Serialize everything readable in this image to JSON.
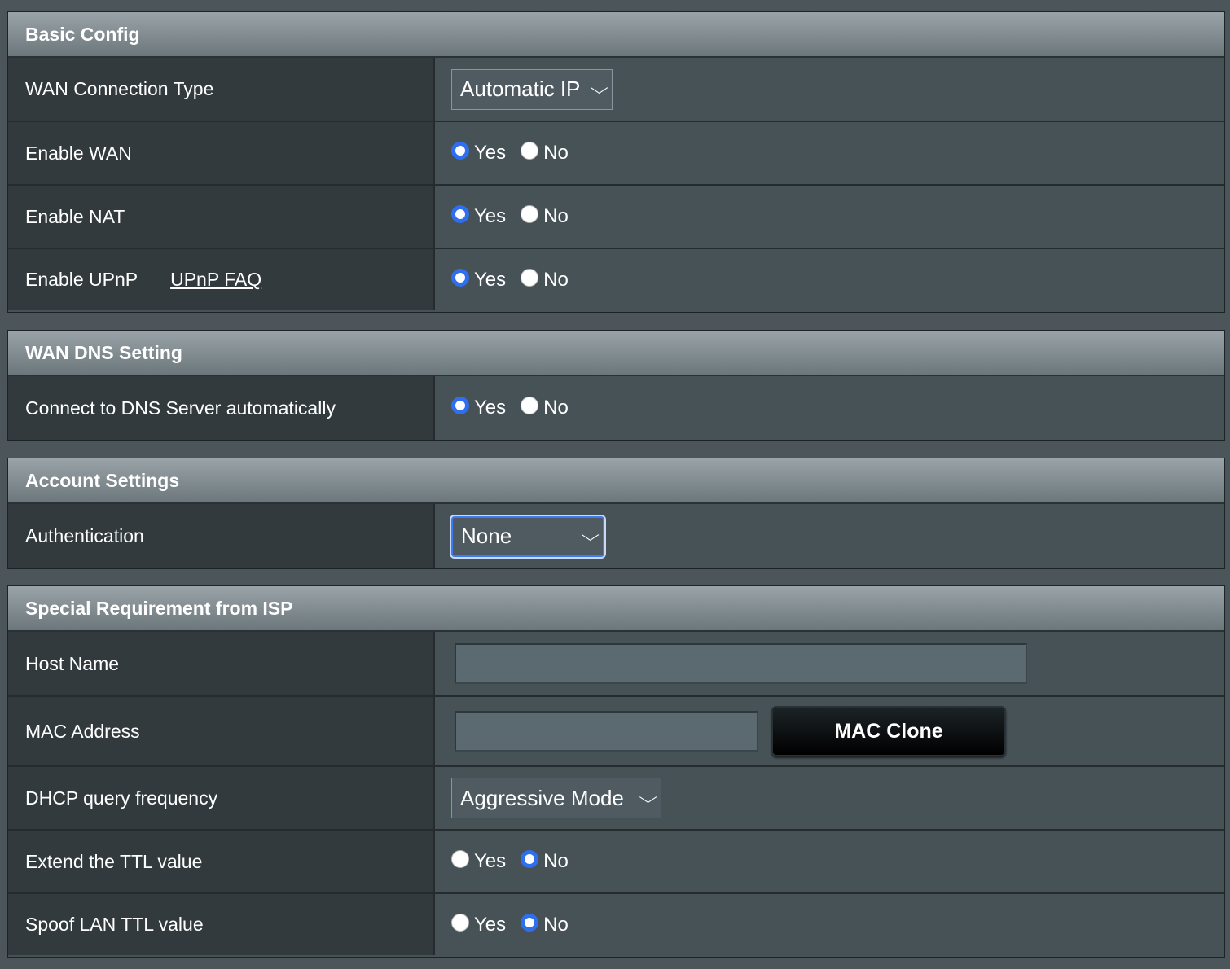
{
  "sections": {
    "basic": {
      "title": "Basic Config",
      "wan_type_label": "WAN Connection Type",
      "wan_type_value": "Automatic IP",
      "enable_wan_label": "Enable WAN",
      "enable_nat_label": "Enable NAT",
      "enable_upnp_label": "Enable UPnP",
      "upnp_faq_link": "UPnP FAQ"
    },
    "dns": {
      "title": "WAN DNS Setting",
      "dns_auto_label": "Connect to DNS Server automatically"
    },
    "account": {
      "title": "Account Settings",
      "auth_label": "Authentication",
      "auth_value": "None"
    },
    "isp": {
      "title": "Special Requirement from ISP",
      "host_name_label": "Host Name",
      "host_name_value": "",
      "mac_label": "MAC Address",
      "mac_value": "",
      "mac_clone_button": "MAC Clone",
      "dhcp_label": "DHCP query frequency",
      "dhcp_value": "Aggressive Mode",
      "ttl_extend_label": "Extend the TTL value",
      "ttl_spoof_label": "Spoof LAN TTL value"
    }
  },
  "radio": {
    "yes": "Yes",
    "no": "No"
  },
  "radio_state": {
    "enable_wan": "Yes",
    "enable_nat": "Yes",
    "enable_upnp": "Yes",
    "dns_auto": "Yes",
    "ttl_extend": "No",
    "ttl_spoof": "No"
  },
  "colors": {
    "accent": "#2e6ff0",
    "header_gradient_top": "#9aa4a8",
    "header_gradient_bottom": "#6c777b",
    "label_bg": "#323a3e",
    "value_bg": "#475257"
  }
}
